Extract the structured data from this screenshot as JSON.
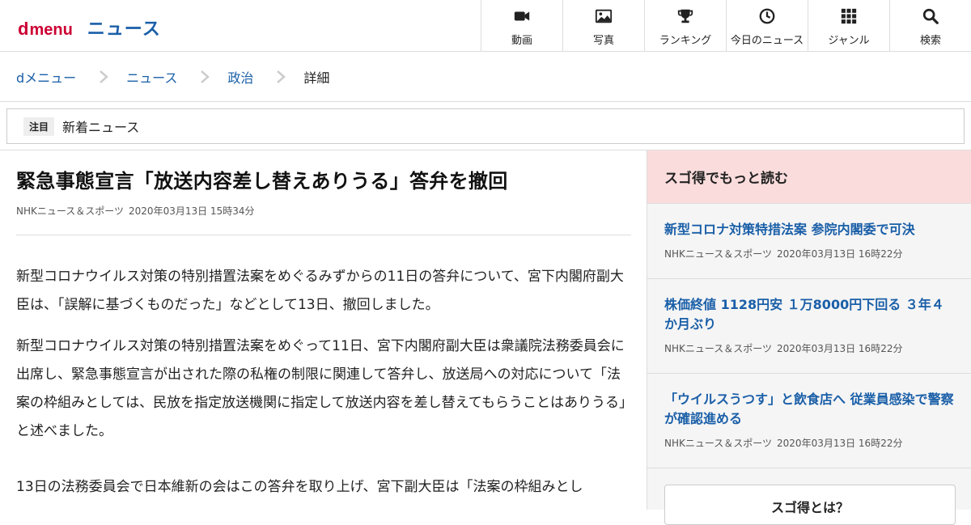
{
  "header": {
    "logo_d": "d",
    "logo_menu": "menu",
    "section": "ニュース",
    "nav": [
      {
        "label": "動画",
        "icon": "video-camera-icon"
      },
      {
        "label": "写真",
        "icon": "photo-icon"
      },
      {
        "label": "ランキング",
        "icon": "trophy-icon"
      },
      {
        "label": "今日のニュース",
        "icon": "clock-icon"
      },
      {
        "label": "ジャンル",
        "icon": "grid-icon"
      },
      {
        "label": "検索",
        "icon": "search-icon"
      }
    ]
  },
  "breadcrumb": [
    "dメニュー",
    "ニュース",
    "政治",
    "詳細"
  ],
  "attention": {
    "badge": "注目",
    "text": "新着ニュース"
  },
  "article": {
    "title": "緊急事態宣言「放送内容差し替えありうる」答弁を撤回",
    "source": "NHKニュース＆スポーツ",
    "date": "2020年03月13日 15時34分",
    "paragraphs": [
      "新型コロナウイルス対策の特別措置法案をめぐるみずからの11日の答弁について、宮下内閣府副大臣は、「誤解に基づくものだった」などとして13日、撤回しました。",
      "新型コロナウイルス対策の特別措置法案をめぐって11日、宮下内閣府副大臣は衆議院法務委員会に出席し、緊急事態宣言が出された際の私権の制限に関連して答弁し、放送局への対応について「法案の枠組みとしては、民放を指定放送機関に指定して放送内容を差し替えてもらうことはありうる」と述べました。",
      "13日の法務委員会で日本維新の会はこの答弁を取り上げ、宮下副大臣は「法案の枠組みとし"
    ]
  },
  "sidebar": {
    "heading": "スゴ得でもっと読む",
    "items": [
      {
        "title": "新型コロナ対策特措法案 参院内閣委で可決",
        "source": "NHKニュース＆スポーツ",
        "date": "2020年03月13日 16時22分"
      },
      {
        "title": "株価終値 1128円安 １万8000円下回る ３年４か月ぶり",
        "source": "NHKニュース＆スポーツ",
        "date": "2020年03月13日 16時22分"
      },
      {
        "title": "「ウイルスうつす」と飲食店へ 従業員感染で警察が確認進める",
        "source": "NHKニュース＆スポーツ",
        "date": "2020年03月13日 16時22分"
      }
    ],
    "about_button": "スゴ得とは？"
  },
  "colors": {
    "brand_red": "#cc0033",
    "link_blue": "#1a5fa8",
    "sidebar_head_bg": "#fadcdc"
  }
}
